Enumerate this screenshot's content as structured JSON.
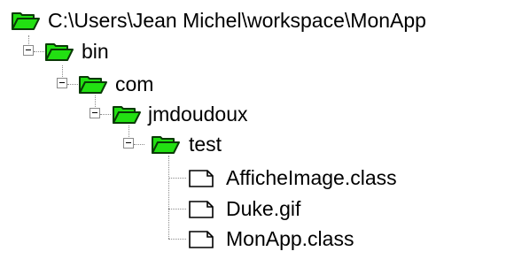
{
  "tree": {
    "root": {
      "label": "C:\\Users\\Jean Michel\\workspace\\MonApp",
      "icon": "open-folder-icon"
    },
    "bin": {
      "label": "bin",
      "icon": "open-folder-icon"
    },
    "com": {
      "label": "com",
      "icon": "open-folder-icon"
    },
    "jmdoudoux": {
      "label": "jmdoudoux",
      "icon": "open-folder-icon"
    },
    "test": {
      "label": "test",
      "icon": "open-folder-icon"
    },
    "files": [
      {
        "label": "AfficheImage.class",
        "icon": "file-icon"
      },
      {
        "label": "Duke.gif",
        "icon": "file-icon"
      },
      {
        "label": "MonApp.class",
        "icon": "file-icon"
      }
    ],
    "expander_icon": "collapse-minus-icon"
  },
  "colors": {
    "folder_fill": "#22e012",
    "folder_stroke": "#0a3a06",
    "connector": "#8a8a8a"
  }
}
